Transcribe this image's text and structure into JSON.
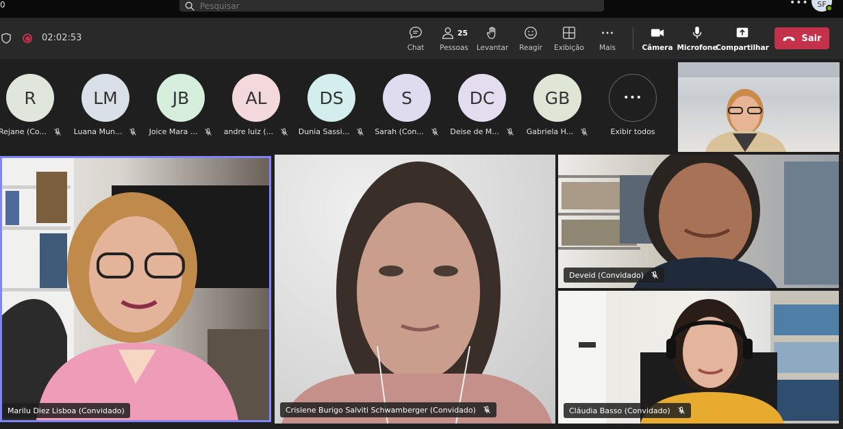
{
  "topbar": {
    "left_glyph": "0",
    "search_placeholder": "Pesquisar",
    "more": "•••",
    "user_initials": "SF"
  },
  "meeting": {
    "timer": "02:02:53",
    "people_count": "25",
    "tools": [
      {
        "label": "Chat",
        "icon": "chat-icon"
      },
      {
        "label": "Pessoas",
        "icon": "people-icon"
      },
      {
        "label": "Levantar",
        "icon": "raise-hand-icon"
      },
      {
        "label": "Reagir",
        "icon": "react-icon"
      },
      {
        "label": "Exibição",
        "icon": "view-icon"
      },
      {
        "label": "Mais",
        "icon": "more-icon"
      },
      {
        "label": "Câmera",
        "icon": "camera-icon"
      },
      {
        "label": "Microfone",
        "icon": "microphone-icon"
      },
      {
        "label": "Compartilhar",
        "icon": "share-icon"
      }
    ],
    "leave_label": "Sair"
  },
  "participants": [
    {
      "initials": "R",
      "name": "Rejane (Co...",
      "color": "#e1e6dc"
    },
    {
      "initials": "LM",
      "name": "Luana Mun...",
      "color": "#d9e0e8"
    },
    {
      "initials": "JB",
      "name": "Joice Mara ...",
      "color": "#d6eedc"
    },
    {
      "initials": "AL",
      "name": "andre luiz (...",
      "color": "#f4d9dc"
    },
    {
      "initials": "DS",
      "name": "Dunia Sassi...",
      "color": "#d3eeec"
    },
    {
      "initials": "S",
      "name": "Sarah (Con...",
      "color": "#e0dcef"
    },
    {
      "initials": "DC",
      "name": "Deise de M...",
      "color": "#e4dcef"
    },
    {
      "initials": "GB",
      "name": "Gabriela H...",
      "color": "#dfe6d5"
    }
  ],
  "show_all": {
    "glyph": "•••",
    "label": "Exibir todos"
  },
  "videos": [
    {
      "name": "Marilu Diez Lisboa (Convidado)"
    },
    {
      "name": "Crislene Burigo Salviti Schwamberger (Convidado)"
    },
    {
      "name": "Deveid (Convidado)"
    },
    {
      "name": "Cláudia Basso (Convidado)"
    }
  ],
  "colors": {
    "accent": "#7f85f5",
    "leave": "#c4314b",
    "status_online": "#6bb700"
  }
}
